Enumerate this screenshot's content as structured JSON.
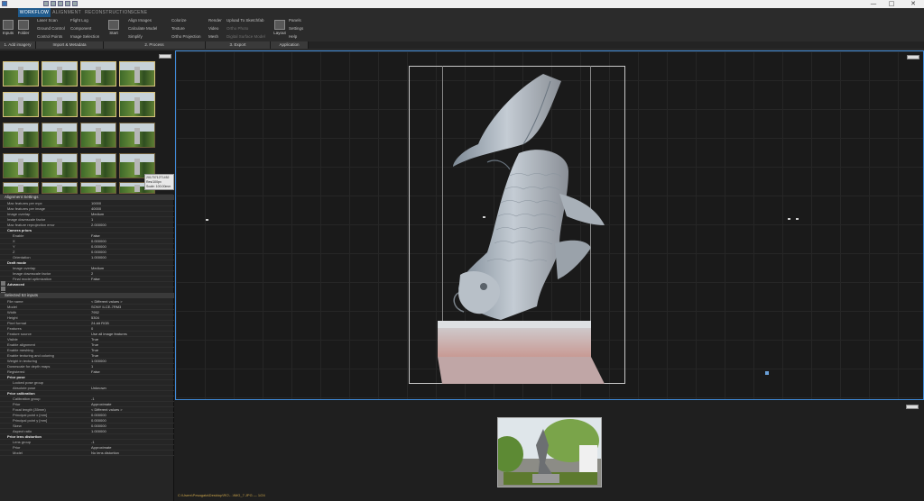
{
  "app": {
    "tabs": [
      "WORKFLOW",
      "ALIGNMENT",
      "RECONSTRUCTION",
      "SCENE"
    ],
    "active_tab": "WORKFLOW"
  },
  "ribbon": {
    "big_buttons": [
      "Inputs",
      "Folder",
      "Start",
      "Layout"
    ],
    "col1": [
      "Laser Scan",
      "Ground Control",
      "Control Points"
    ],
    "col2": [
      "Flight Log",
      "Component",
      "Image Selection"
    ],
    "col3": [
      "Align Images",
      "Calculate Model",
      "Simplify"
    ],
    "col4": [
      "Colorize",
      "Texture",
      "Ortho Projection"
    ],
    "col5": [
      "Render",
      "Video",
      "Mesh"
    ],
    "col6": [
      "Upload To Sketchfab",
      "Ortho Photo",
      "Digital Surface Model"
    ],
    "col7": [
      "Panels",
      "Settings",
      "Help"
    ],
    "groups": [
      "1. Add imagery",
      "Import & Metadata",
      "2. Process",
      "3. Export",
      "Application"
    ]
  },
  "tooltip": {
    "lines": [
      "20170712T1452",
      "Res/100px",
      "Scale: 100.00mm"
    ]
  },
  "alignment": {
    "title": "Alignment Settings",
    "rows": [
      {
        "k": "Max features per mpx",
        "v": "10000"
      },
      {
        "k": "Max features per image",
        "v": "40000"
      },
      {
        "k": "Image overlap",
        "v": "Medium"
      },
      {
        "k": "Image downscale factor",
        "v": "1"
      },
      {
        "k": "Max feature reprojection error",
        "v": "2.000000"
      }
    ],
    "camera_priors": "Camera priors",
    "camera_rows": [
      {
        "k": "Enable",
        "v": "False"
      },
      {
        "k": "X",
        "v": "0.000000"
      },
      {
        "k": "Y",
        "v": "0.000000"
      },
      {
        "k": "Z",
        "v": "0.000000"
      },
      {
        "k": "Orientation",
        "v": "1.000000"
      }
    ],
    "draft_mode": "Draft mode",
    "draft_rows": [
      {
        "k": "Image overlap",
        "v": "Medium"
      },
      {
        "k": "Image downscale factor",
        "v": "2"
      },
      {
        "k": "Final model optimization",
        "v": "False"
      }
    ],
    "advanced": "Advanced"
  },
  "selected": {
    "title": "Selected 53 inputs",
    "rows": [
      {
        "k": "File name",
        "v": "< Different values >"
      },
      {
        "k": "Model",
        "v": "SONY ILCE-7RM3"
      },
      {
        "k": "Width",
        "v": "7952"
      },
      {
        "k": "Height",
        "v": "5304"
      },
      {
        "k": "Pixel format",
        "v": "24-bit RGB"
      },
      {
        "k": "Features",
        "v": "0"
      },
      {
        "k": "Feature source",
        "v": "Use all image features"
      },
      {
        "k": "Visible",
        "v": "True"
      },
      {
        "k": "Enable alignment",
        "v": "True"
      },
      {
        "k": "Enable meshing",
        "v": "True"
      },
      {
        "k": "Enable texturing and coloring",
        "v": "True"
      },
      {
        "k": "Weight in texturing",
        "v": "1.000000"
      },
      {
        "k": "Downscale for depth maps",
        "v": "1"
      },
      {
        "k": "Registered",
        "v": "False"
      }
    ],
    "prior_pose": "Prior pose",
    "pose_rows": [
      {
        "k": "Locked pose group",
        "v": ""
      },
      {
        "k": "Absolute pose",
        "v": "Unknown"
      }
    ],
    "prior_calibration": "Prior calibration",
    "calib_rows": [
      {
        "k": "Calibration group",
        "v": "-1"
      },
      {
        "k": "Prior",
        "v": "Approximate"
      },
      {
        "k": "Focal length (35mm)",
        "v": "< Different values >"
      },
      {
        "k": "Principal point x [mm]",
        "v": "0.000000"
      },
      {
        "k": "Principal point y [mm]",
        "v": "0.000000"
      },
      {
        "k": "Skew",
        "v": "0.000000"
      },
      {
        "k": "Aspect ratio",
        "v": "1.000000"
      }
    ],
    "prior_lens": "Prior lens distortion",
    "lens_rows": [
      {
        "k": "Lens group",
        "v": "-1"
      },
      {
        "k": "Prior",
        "v": "Approximate"
      },
      {
        "k": "Model",
        "v": "No lens distortion"
      }
    ]
  },
  "status": "C:\\Users\\Pesagata\\Desktop\\RC\\...\\IMG_7.JPG — 1/24"
}
